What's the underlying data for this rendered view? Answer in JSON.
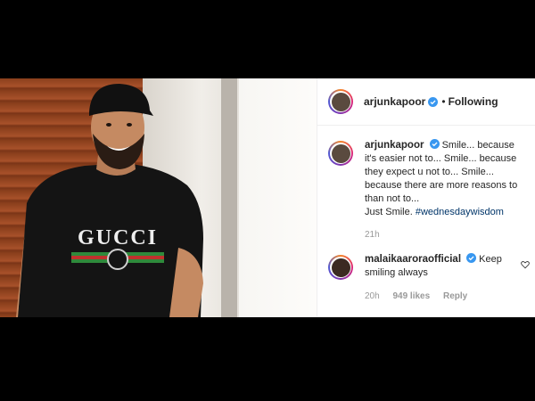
{
  "header": {
    "username": "arjunkapoor",
    "separator": "•",
    "follow_status": "Following"
  },
  "caption": {
    "username": "arjunkapoor",
    "line1": "Smile... because it's easier not to... Smile... because they expect u not to... Smile... because there are more reasons to than not to...",
    "line2_prefix": "Just Smile.",
    "hashtag": "#wednesdaywisdom",
    "time": "21h"
  },
  "comment": {
    "username": "malaikaaroraofficial",
    "text": "Keep smiling always",
    "time": "20h",
    "likes": "949 likes",
    "reply": "Reply"
  },
  "photo": {
    "shirt_text": "GUCCI"
  },
  "colors": {
    "verified": "#3897f0",
    "hashtag": "#003569",
    "meta": "#999999"
  }
}
